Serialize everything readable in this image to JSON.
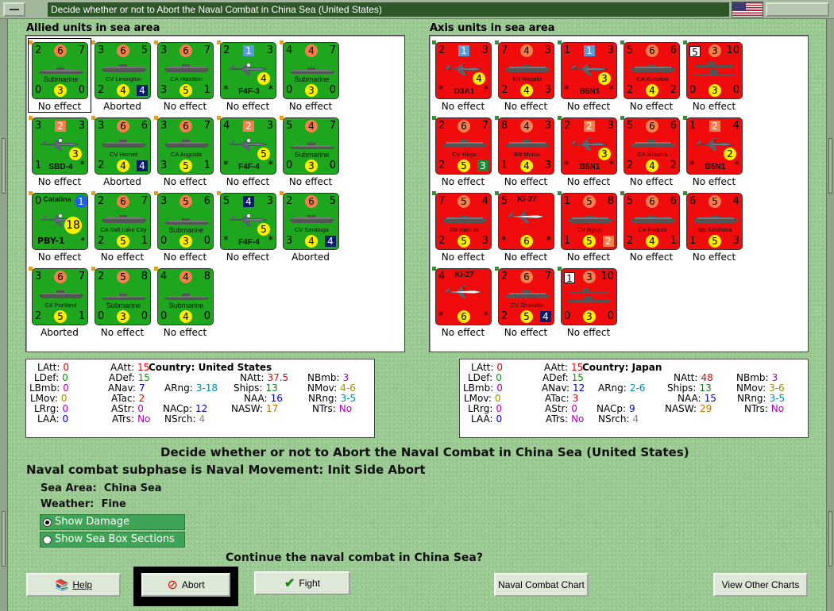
{
  "window": {
    "title": "Decide whether or not to Abort the Naval Combat in China Sea (United States)"
  },
  "panels": {
    "allied_title": "Allied units in sea area",
    "axis_title": "Axis units in sea area"
  },
  "allied_units": [
    {
      "tl": "2",
      "tc": "6",
      "tr": "7",
      "name": "Submarine",
      "bl": "0",
      "bc": "3",
      "br": "0",
      "effect": "No effect",
      "kind": "sub",
      "selected": true
    },
    {
      "tl": "3",
      "tc": "6",
      "tr": "5",
      "name": "CV Lexington",
      "bl": "2",
      "bc": "4",
      "br": "4",
      "effect": "Aborted",
      "kind": "cv",
      "brbox": "nv"
    },
    {
      "tl": "3",
      "tc": "6",
      "tr": "7",
      "name": "CA Houston",
      "bl": "3",
      "bc": "5",
      "br": "1",
      "effect": "No effect",
      "kind": "ca"
    },
    {
      "tl": "2",
      "tc": "1",
      "tr": "3",
      "name": "F4F-3",
      "bl": "*",
      "bc": "4",
      "br": "*",
      "effect": "No effect",
      "kind": "plane",
      "tcbox": "bl"
    },
    {
      "tl": "4",
      "tc": "4",
      "tr": "7",
      "name": "Submarine",
      "bl": "0",
      "bc": "3",
      "br": "0",
      "effect": "No effect",
      "kind": "sub"
    },
    {
      "tl": "3",
      "tc": "2",
      "tr": "3",
      "name": "SBD-4",
      "bl": "1",
      "bc": "3",
      "br": "*",
      "effect": "No effect",
      "kind": "plane",
      "tcbox": "or"
    },
    {
      "tl": "3",
      "tc": "6",
      "tr": "6",
      "name": "CV Hornet",
      "bl": "2",
      "bc": "4",
      "br": "4",
      "effect": "Aborted",
      "kind": "cv",
      "brbox": "nv"
    },
    {
      "tl": "3",
      "tc": "6",
      "tr": "7",
      "name": "CA Augusta",
      "bl": "3",
      "bc": "5",
      "br": "1",
      "effect": "No effect",
      "kind": "ca"
    },
    {
      "tl": "4",
      "tc": "2",
      "tr": "3",
      "name": "F4F-4",
      "bl": "*",
      "bc": "5",
      "br": "*",
      "effect": "No effect",
      "kind": "plane",
      "tcbox": "or"
    },
    {
      "tl": "5",
      "tc": "4",
      "tr": "7",
      "name": "Submarine",
      "bl": "0",
      "bc": "3",
      "br": "0",
      "effect": "No effect",
      "kind": "sub"
    },
    {
      "tl": "0",
      "tc": "1",
      "tr": "",
      "name": "Catalina",
      "bl": "PBY-1",
      "bc": "18",
      "br": "*",
      "effect": "No effect",
      "kind": "catalina"
    },
    {
      "tl": "2",
      "tc": "6",
      "tr": "7",
      "name": "CA Salt Lake City",
      "bl": "2",
      "bc": "5",
      "br": "1",
      "effect": "No effect",
      "kind": "ca"
    },
    {
      "tl": "3",
      "tc": "5",
      "tr": "6",
      "name": "Submarine",
      "bl": "0",
      "bc": "3",
      "br": "0",
      "effect": "No effect",
      "kind": "sub"
    },
    {
      "tl": "5",
      "tc": "4",
      "tr": "3",
      "name": "F4F-4",
      "bl": "*",
      "bc": "5",
      "br": "*",
      "effect": "No effect",
      "kind": "plane",
      "tcbox": "nv"
    },
    {
      "tl": "2",
      "tc": "6",
      "tr": "5",
      "name": "CV Saratoga",
      "bl": "3",
      "bc": "4",
      "br": "4",
      "effect": "Aborted",
      "kind": "cv",
      "brbox": "nv"
    },
    {
      "tl": "3",
      "tc": "6",
      "tr": "7",
      "name": "CA Portland",
      "bl": "2",
      "bc": "5",
      "br": "1",
      "effect": "Aborted",
      "kind": "ca"
    },
    {
      "tl": "2",
      "tc": "5",
      "tr": "8",
      "name": "Submarine",
      "bl": "0",
      "bc": "3",
      "br": "0",
      "effect": "No effect",
      "kind": "sub"
    },
    {
      "tl": "4",
      "tc": "4",
      "tr": "8",
      "name": "Submarine",
      "bl": "0",
      "bc": "4",
      "br": "0",
      "effect": "No effect",
      "kind": "sub"
    }
  ],
  "axis_units": [
    {
      "tl": "2",
      "tc": "1",
      "tr": "3",
      "name": "D3A1",
      "bl": "*",
      "bc": "4",
      "br": "*",
      "effect": "No effect",
      "kind": "plane",
      "tcbox": "bl"
    },
    {
      "tl": "7",
      "tc": "4",
      "tr": "3",
      "name": "BB Nagato",
      "bl": "2",
      "bc": "4",
      "br": "3",
      "effect": "No effect",
      "kind": "bb"
    },
    {
      "tl": "1",
      "tc": "1",
      "tr": "3",
      "name": "B5N1",
      "bl": "*",
      "bc": "3",
      "br": "*",
      "effect": "No effect",
      "kind": "plane",
      "tcbox": "bl"
    },
    {
      "tl": "5",
      "tc": "6",
      "tr": "6",
      "name": "CA Kumano",
      "bl": "2",
      "bc": "4",
      "br": "2",
      "effect": "No effect",
      "kind": "ca"
    },
    {
      "tl": "5",
      "tc": "3",
      "tr": "10",
      "name": "",
      "bl": "0",
      "bc": "3",
      "br": "0",
      "effect": "No effect",
      "kind": "convoy",
      "tlbox": "wh"
    },
    {
      "tl": "2",
      "tc": "6",
      "tr": "7",
      "name": "CV Hiryu",
      "bl": "2",
      "bc": "5",
      "br": "3",
      "effect": "No effect",
      "kind": "cv",
      "brbox": "gr"
    },
    {
      "tl": "8",
      "tc": "4",
      "tr": "3",
      "name": "BB Mutsu",
      "bl": "1",
      "bc": "4",
      "br": "3",
      "effect": "No effect",
      "kind": "bb"
    },
    {
      "tl": "2",
      "tc": "2",
      "tr": "3",
      "name": "B5N1",
      "bl": "*",
      "bc": "3",
      "br": "*",
      "effect": "No effect",
      "kind": "plane",
      "tcbox": "or"
    },
    {
      "tl": "5",
      "tc": "6",
      "tr": "6",
      "name": "CA Mikuma",
      "bl": "2",
      "bc": "4",
      "br": "2",
      "effect": "No effect",
      "kind": "ca"
    },
    {
      "tl": "1",
      "tc": "2",
      "tr": "4",
      "name": "B5N1",
      "bl": "*",
      "bc": "2",
      "br": "*",
      "effect": "No effect",
      "kind": "plane",
      "tcbox": "or"
    },
    {
      "tl": "7",
      "tc": "5",
      "tr": "4",
      "name": "BB Haruna",
      "bl": "2",
      "bc": "5",
      "br": "3",
      "effect": "No effect",
      "kind": "bb"
    },
    {
      "tl": "5",
      "tc": "",
      "tr": "",
      "name": "Ki-27",
      "bl": "*",
      "bc": "6",
      "br": "*",
      "effect": "No effect",
      "kind": "ki27"
    },
    {
      "tl": "1",
      "tc": "5",
      "tr": "8",
      "name": "CV Ryujo",
      "bl": "1",
      "bc": "5",
      "br": "2",
      "effect": "No effect",
      "kind": "cv",
      "brbox": "or"
    },
    {
      "tl": "5",
      "tc": "6",
      "tr": "6",
      "name": "CA Haguro",
      "bl": "2",
      "bc": "4",
      "br": "1",
      "effect": "No effect",
      "kind": "ca"
    },
    {
      "tl": "6",
      "tc": "5",
      "tr": "4",
      "name": "BB Kirishima",
      "bl": "1",
      "bc": "5",
      "br": "3",
      "effect": "No effect",
      "kind": "bb"
    },
    {
      "tl": "4",
      "tc": "",
      "tr": "",
      "name": "Ki-27",
      "bl": "*",
      "bc": "6",
      "br": "*",
      "effect": "No effect",
      "kind": "ki27"
    },
    {
      "tl": "2",
      "tc": "6",
      "tr": "7",
      "name": "CV Shokaku",
      "bl": "2",
      "bc": "5",
      "br": "4",
      "effect": "No effect",
      "kind": "cv",
      "brbox": "nv"
    },
    {
      "tl": "1",
      "tc": "3",
      "tr": "10",
      "name": "",
      "bl": "0",
      "bc": "3",
      "br": "0",
      "effect": "No effect",
      "kind": "convoy",
      "tlbox": "wh"
    }
  ],
  "allied_stats": {
    "country_label": "Country:",
    "country": "United States",
    "LAtt": "0",
    "LDef": "0",
    "LBmb": "0",
    "LMov": "0",
    "LRrg": "0",
    "LAA": "0",
    "AAtt": "15",
    "ADef": "15",
    "ANav": "7",
    "ATac": "2",
    "AStr": "0",
    "ATrs": "No",
    "ARng": "3-18",
    "NACp": "12",
    "NSrch": "4",
    "NAtt": "37.5",
    "Ships": "13",
    "NAA": "16",
    "NASW": "17",
    "NBmb": "3",
    "NMov": "4-6",
    "NRng": "3-5",
    "NTrs": "No"
  },
  "axis_stats": {
    "country_label": "Country:",
    "country": "Japan",
    "LAtt": "0",
    "LDef": "0",
    "LBmb": "0",
    "LMov": "0",
    "LRrg": "0",
    "LAA": "0",
    "AAtt": "15",
    "ADef": "15",
    "ANav": "12",
    "ATac": "3",
    "AStr": "0",
    "ATrs": "No",
    "ARng": "2-6",
    "NACp": "9",
    "NSrch": "4",
    "NAtt": "48",
    "Ships": "13",
    "NAA": "15",
    "NASW": "29",
    "NBmb": "3",
    "NMov": "3-6",
    "NRng": "3-5",
    "NTrs": "No"
  },
  "info": {
    "heading": "Decide whether or not to Abort the Naval Combat in China Sea (United States)",
    "subphase": "Naval combat subphase is Naval Movement: Init Side Abort",
    "sea_area_label": "Sea Area:",
    "sea_area": "China Sea",
    "weather_label": "Weather:",
    "weather": "Fine",
    "show_damage": "Show Damage",
    "show_sea_box": "Show Sea Box Sections",
    "question": "Continue the naval combat in China Sea?"
  },
  "buttons": {
    "help": "Help",
    "abort": "Abort",
    "fight": "Fight",
    "naval_chart": "Naval Combat Chart",
    "other_charts": "View Other Charts"
  },
  "colors": {
    "allied": "#1ea61e",
    "axis": "#f00c0c",
    "highlight_green": "#3fa456"
  }
}
